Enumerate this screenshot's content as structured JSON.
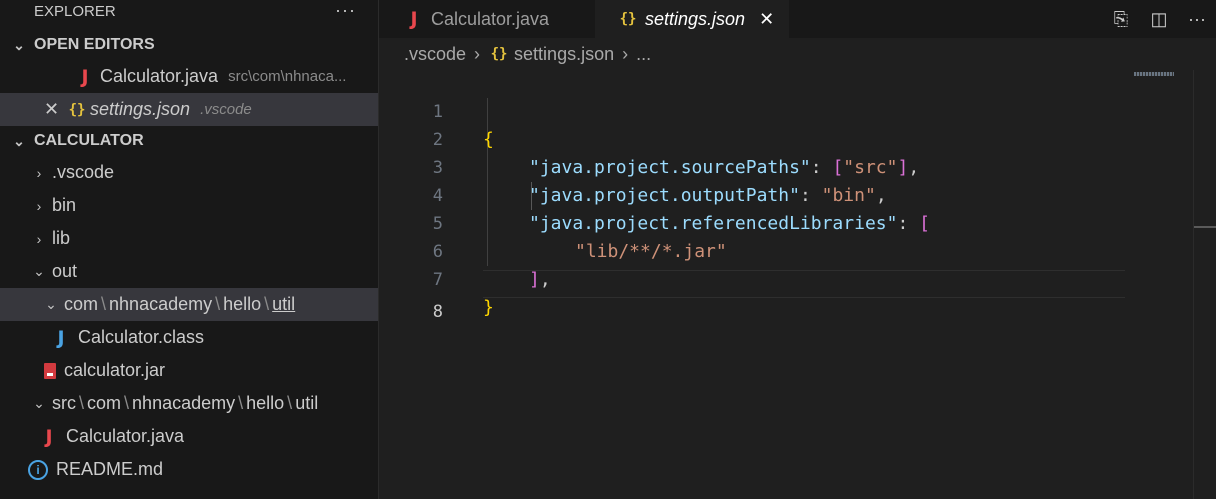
{
  "sidebar": {
    "title": "EXPLORER",
    "more": "···",
    "open_editors": {
      "label": "OPEN EDITORS",
      "items": [
        {
          "name": "Calculator.java",
          "path": "src\\com\\nhnaca...",
          "icon": "java-icon"
        },
        {
          "name": "settings.json",
          "path": ".vscode",
          "icon": "json-icon",
          "close": "✕"
        }
      ]
    },
    "project": {
      "label": "CALCULATOR",
      "items": [
        {
          "label": ".vscode"
        },
        {
          "label": "bin"
        },
        {
          "label": "lib"
        },
        {
          "label": "out"
        },
        {
          "parts": [
            "com",
            "nhnacademy",
            "hello",
            "util"
          ]
        },
        {
          "label": "Calculator.class"
        },
        {
          "label": "calculator.jar"
        },
        {
          "parts": [
            "src",
            "com",
            "nhnacademy",
            "hello",
            "util"
          ]
        },
        {
          "label": "Calculator.java"
        },
        {
          "label": "README.md"
        }
      ]
    }
  },
  "tabs": [
    {
      "label": "Calculator.java",
      "icon": "J"
    },
    {
      "label": "settings.json",
      "icon": "{}",
      "close": "✕"
    }
  ],
  "breadcrumb": [
    ".vscode",
    "settings.json",
    "..."
  ],
  "editor": {
    "line_numbers": [
      "1",
      "2",
      "3",
      "4",
      "5",
      "6",
      "7",
      "8"
    ],
    "current_line": "8",
    "tokens": {
      "l1_open": "{",
      "l2_key": "\"java.project.sourcePaths\"",
      "l2_colon": ": ",
      "l2_open": "[",
      "l2_val": "\"src\"",
      "l2_close": "]",
      "l2_comma": ",",
      "l3_key": "\"java.project.outputPath\"",
      "l3_colon": ": ",
      "l3_val": "\"bin\"",
      "l3_comma": ",",
      "l4_key": "\"java.project.referencedLibraries\"",
      "l4_colon": ": ",
      "l4_open": "[",
      "l5_val": "\"lib/**/*.jar\"",
      "l6_close": "]",
      "l6_comma": ",",
      "l7_close": "}"
    }
  }
}
